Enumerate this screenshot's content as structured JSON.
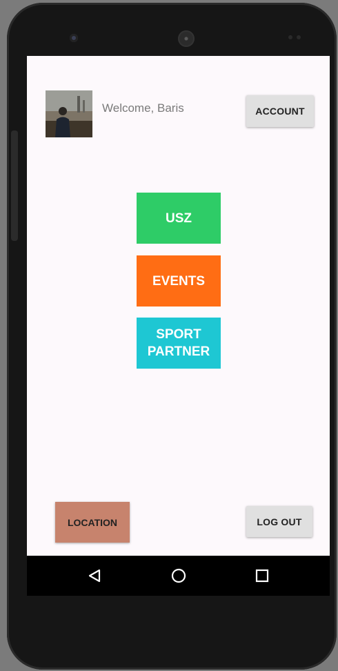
{
  "header": {
    "welcome_text": "Welcome, Baris",
    "account_label": "ACCOUNT"
  },
  "menu": [
    {
      "label": "USZ",
      "color": "#2ecc67"
    },
    {
      "label": "EVENTS",
      "color": "#ff6d14"
    },
    {
      "label": "SPORT PARTNER",
      "color": "#1ec7d3"
    }
  ],
  "footer": {
    "location_label": "LOCATION",
    "location_color": "#c7836d",
    "logout_label": "LOG OUT"
  },
  "navbar": {
    "icons": [
      "back-icon",
      "home-icon",
      "recents-icon"
    ]
  }
}
